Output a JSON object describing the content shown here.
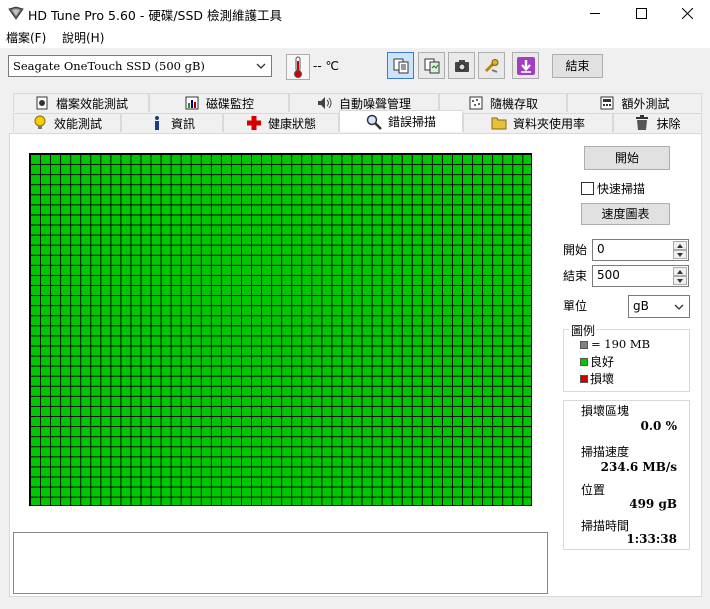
{
  "window": {
    "title": "HD Tune Pro 5.60 - 硬碟/SSD 檢測維護工具",
    "controls": {
      "minimize": "minimize",
      "maximize": "maximize",
      "close": "close"
    }
  },
  "menu": [
    {
      "label": "檔案(F)"
    },
    {
      "label": "說明(H)"
    }
  ],
  "toolbar": {
    "drive": "Seagate OneTouch SSD (500 gB)",
    "temperature": "-- ℃",
    "exit_label": "結束",
    "buttons": [
      "copy-text-icon",
      "copy-icon",
      "camera-icon",
      "tools-icon",
      "download-icon"
    ]
  },
  "tabs": {
    "row1": [
      "檔案效能測試",
      "磁碟監控",
      "自動噪聲管理",
      "隨機存取",
      "額外測試"
    ],
    "row2": [
      "效能測試",
      "資訊",
      "健康狀態",
      "錯誤掃描",
      "資料夾使用率",
      "抹除"
    ],
    "selected": "錯誤掃描"
  },
  "scan": {
    "start_button": "開始",
    "quick_scan_label": "快速掃描",
    "quick_scan_checked": false,
    "speed_chart_button": "速度圖表",
    "start_label": "開始",
    "start_value": "0",
    "end_label": "結束",
    "end_value": "500",
    "unit_label": "單位",
    "unit_value": "gB"
  },
  "legend": {
    "title": "圖例",
    "items": [
      {
        "label": "= 190 MB",
        "color": "#808080"
      },
      {
        "label": "良好",
        "color": "#00c800"
      },
      {
        "label": "損壞",
        "color": "#c80000"
      }
    ]
  },
  "stats": [
    {
      "label": "損壞區塊",
      "value": "0.0 %"
    },
    {
      "label": "掃描速度",
      "value": "234.6 MB/s"
    },
    {
      "label": "位置",
      "value": "499 gB"
    },
    {
      "label": "掃描時間",
      "value": "1:33:38"
    }
  ],
  "colors": {
    "good": "#00c800",
    "bad": "#c80000",
    "accent": "#3a7bd5"
  }
}
